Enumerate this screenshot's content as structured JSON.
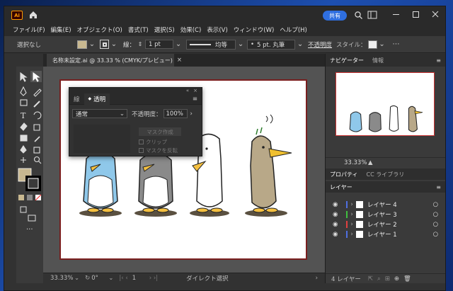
{
  "app": {
    "logo": "Ai"
  },
  "titlebar": {
    "share_label": "共有"
  },
  "menu": [
    "ファイル(F)",
    "編集(E)",
    "オブジェクト(O)",
    "書式(T)",
    "選択(S)",
    "効果(C)",
    "表示(V)",
    "ウィンドウ(W)",
    "ヘルプ(H)"
  ],
  "control": {
    "selection": "選択なし",
    "stroke_label": "線：",
    "stroke_weight": "1 pt",
    "profile": "均等",
    "brush": "5 pt. 丸筆",
    "opacity_label": "不透明度",
    "style_label": "スタイル："
  },
  "document": {
    "tab": "名称未設定.ai @ 33.33 % (CMYK/プレビュー)"
  },
  "transparency_panel": {
    "tab_stroke": "線",
    "tab_transparency": "透明",
    "blend_mode": "通常",
    "opacity_label": "不透明度：",
    "opacity_value": "100%",
    "make_mask": "マスク作成",
    "clip": "クリップ",
    "invert_mask": "マスクを反転"
  },
  "status": {
    "zoom": "33.33%",
    "rotation": "0°",
    "page": "1",
    "tool": "ダイレクト選択"
  },
  "navigator": {
    "tab_navigator": "ナビゲーター",
    "tab_info": "情報",
    "zoom": "33.33%"
  },
  "properties": {
    "tab_properties": "プロパティ",
    "tab_libraries": "CC ライブラリ"
  },
  "layers": {
    "tab": "レイヤー",
    "items": [
      {
        "name": "レイヤー 4",
        "color": "#4f6fe0"
      },
      {
        "name": "レイヤー 3",
        "color": "#3fbf3f"
      },
      {
        "name": "レイヤー 2",
        "color": "#e04040"
      },
      {
        "name": "レイヤー 1",
        "color": "#4f6fe0"
      }
    ],
    "count": "4 レイヤー"
  },
  "colors": {
    "fill": "#c8b890",
    "accent": "#2f6fe0"
  }
}
